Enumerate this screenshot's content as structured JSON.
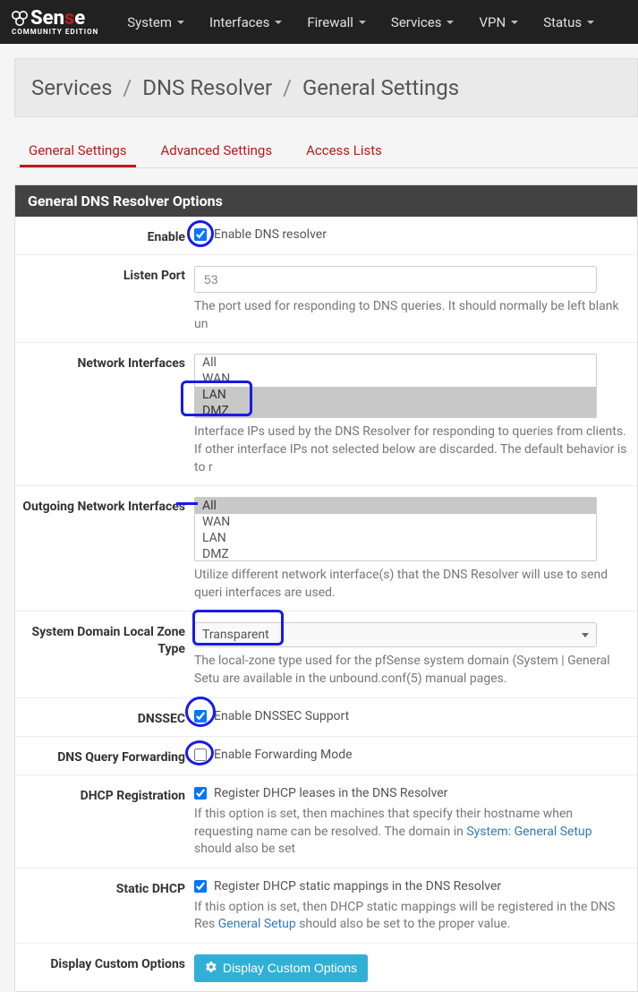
{
  "brand": {
    "name_pre": "Sen",
    "name_red": "s",
    "name_post": "e",
    "subtitle": "COMMUNITY EDITION"
  },
  "nav": {
    "system": "System",
    "interfaces": "Interfaces",
    "firewall": "Firewall",
    "services": "Services",
    "vpn": "VPN",
    "status": "Status"
  },
  "breadcrumb": {
    "a": "Services",
    "b": "DNS Resolver",
    "c": "General Settings"
  },
  "tabs": {
    "general": "General Settings",
    "advanced": "Advanced Settings",
    "access": "Access Lists"
  },
  "panel_title": "General DNS Resolver Options",
  "labels": {
    "enable": "Enable",
    "listen_port": "Listen Port",
    "network_interfaces": "Network Interfaces",
    "outgoing_interfaces": "Outgoing Network Interfaces",
    "zone_type": "System Domain Local Zone Type",
    "dnssec": "DNSSEC",
    "forwarding": "DNS Query Forwarding",
    "dhcp_reg": "DHCP Registration",
    "static_dhcp": "Static DHCP",
    "custom": "Display Custom Options"
  },
  "fields": {
    "enable_label": "Enable DNS resolver",
    "listen_port_value": "53",
    "listen_port_help": "The port used for responding to DNS queries. It should normally be left blank un",
    "ni_options": {
      "all": "All",
      "wan": "WAN",
      "lan": "LAN",
      "dmz": "DMZ"
    },
    "ni_help": "Interface IPs used by the DNS Resolver for responding to queries from clients. If other interface IPs not selected below are discarded. The default behavior is to r",
    "oi_options": {
      "all": "All",
      "wan": "WAN",
      "lan": "LAN",
      "dmz": "DMZ"
    },
    "oi_help": "Utilize different network interface(s) that the DNS Resolver will use to send queri interfaces are used.",
    "zone_value": "Transparent",
    "zone_help_a": "The local-zone type used for the pfSense system domain (System | General Setu",
    "zone_help_b": " are available in the unbound.conf(5) manual pages.",
    "dnssec_label": "Enable DNSSEC Support",
    "forwarding_label": "Enable Forwarding Mode",
    "dhcp_reg_label": "Register DHCP leases in the DNS Resolver",
    "dhcp_reg_help_a": "If this option is set, then machines that specify their hostname when requesting name can be resolved. The domain in ",
    "dhcp_reg_link": "System: General Setup",
    "dhcp_reg_help_b": " should also be set",
    "static_label": "Register DHCP static mappings in the DNS Resolver",
    "static_help_a": "If this option is set, then DHCP static mappings will be registered in the DNS Res ",
    "static_link": "General Setup",
    "static_help_b": " should also be set to the proper value.",
    "custom_btn": "Display Custom Options"
  }
}
